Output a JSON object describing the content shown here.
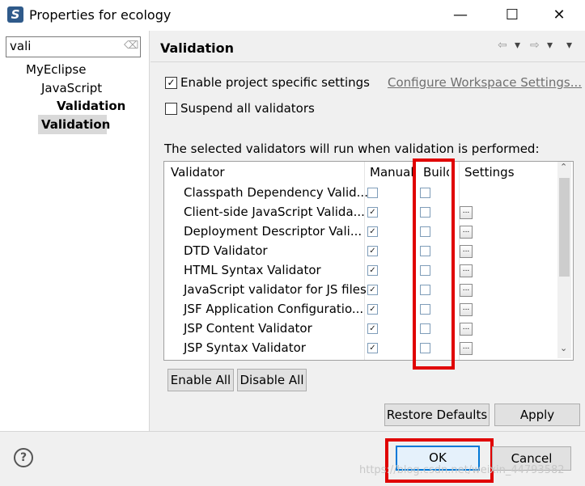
{
  "window": {
    "title": "Properties for ecology",
    "minimize": "—",
    "maximize": "☐",
    "close": "✕",
    "app_icon_glyph": "S"
  },
  "filter": {
    "value": "vali",
    "clear_icon": "⌫"
  },
  "tree": {
    "items": [
      "MyEclipse",
      "JavaScript",
      "Validation",
      "Validation"
    ]
  },
  "page": {
    "title": "Validation",
    "nav_back": "⇦",
    "nav_back_menu": "▾",
    "nav_fwd": "⇨",
    "nav_fwd_menu": "▾",
    "view_menu": "▾",
    "enable_specific": "Enable project specific settings",
    "configure_link": "Configure Workspace Settings...",
    "suspend_all": "Suspend all validators",
    "description": "The selected validators will run when validation is performed:"
  },
  "table": {
    "headers": [
      "Validator",
      "Manual",
      "Build",
      "Settings"
    ],
    "rows": [
      {
        "name": "Classpath Dependency Valid...",
        "manual": false,
        "build": false,
        "settings": false
      },
      {
        "name": "Client-side JavaScript Valida...",
        "manual": true,
        "build": false,
        "settings": true
      },
      {
        "name": "Deployment Descriptor Vali...",
        "manual": true,
        "build": false,
        "settings": true
      },
      {
        "name": "DTD Validator",
        "manual": true,
        "build": false,
        "settings": true
      },
      {
        "name": "HTML Syntax Validator",
        "manual": true,
        "build": false,
        "settings": true
      },
      {
        "name": "JavaScript validator for JS files",
        "manual": true,
        "build": false,
        "settings": true
      },
      {
        "name": "JSF Application Configuratio...",
        "manual": true,
        "build": false,
        "settings": true
      },
      {
        "name": "JSP Content Validator",
        "manual": true,
        "build": false,
        "settings": true
      },
      {
        "name": "JSP Syntax Validator",
        "manual": true,
        "build": false,
        "settings": true
      }
    ],
    "settings_glyph": "...",
    "check_glyph": "✓",
    "scroll_up": "⌃",
    "scroll_down": "⌄"
  },
  "buttons": {
    "enable_all": "Enable All",
    "disable_all": "Disable All",
    "restore_defaults": "Restore Defaults",
    "apply": "Apply",
    "ok": "OK",
    "cancel": "Cancel",
    "help": "?"
  },
  "watermark": "https://blog.csdn.net/weixin_44793582",
  "colors": {
    "highlight_red": "#e00000",
    "ok_focus": "#0078d7"
  }
}
